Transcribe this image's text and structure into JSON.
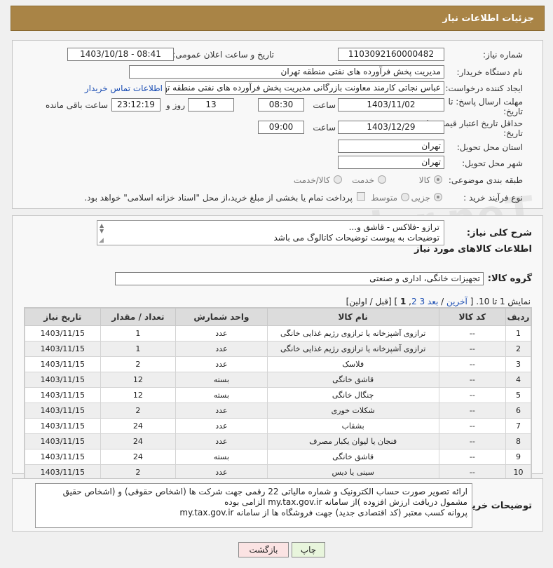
{
  "header": {
    "title": "جزئیات اطلاعات نیاز"
  },
  "form": {
    "need_number_label": "شماره نیاز:",
    "need_number": "1103092160000482",
    "announce_label": "تاریخ و ساعت اعلان عمومی:",
    "announce_value": "1403/10/18 - 08:41",
    "buyer_org_label": "نام دستگاه خریدار:",
    "buyer_org": "مدیریت پخش فرآورده های نفتی منطقه تهران",
    "creator_label": "ایجاد کننده درخواست:",
    "creator": "عباس نجاتی کارمند معاونت بازرگانی مدیریت پخش فرآورده های نفتی منطقه تهران",
    "contact_link": "اطلاعات تماس خریدار",
    "deadline_label": "مهلت ارسال پاسخ: تا تاریخ:",
    "deadline_date": "1403/11/02",
    "time_label": "ساعت",
    "deadline_time": "08:30",
    "days_value": "13",
    "days_label": "روز و",
    "remaining_time": "23:12:19",
    "remaining_label": "ساعت باقی مانده",
    "validity_label": "حداقل تاریخ اعتبار قیمت: تا تاریخ:",
    "validity_date": "1403/12/29",
    "validity_time": "09:00",
    "province_label": "استان محل تحویل:",
    "province": "تهران",
    "city_label": "شهر محل تحویل:",
    "city": "تهران",
    "category_label": "طبقه بندی موضوعی:",
    "category_options": [
      "کالا",
      "خدمت",
      "کالا/خدمت"
    ],
    "category_selected": "کالا",
    "process_label": "نوع فرآیند خرید :",
    "process_options": [
      "جزیی",
      "متوسط"
    ],
    "process_selected": "جزیی",
    "payment_note": "پرداخت تمام یا بخشی از مبلغ خرید،از محل \"اسناد خزانه اسلامی\" خواهد بود."
  },
  "description": {
    "label": "شرح کلی نیاز:",
    "line1": "ترازو -فلاکس - قاشق و...",
    "line2": "توضیحات به پیوست توضیحات کاتالوگ می باشد"
  },
  "goods": {
    "section_title": "اطلاعات کالاهای مورد نیاز",
    "group_label": "گروه کالا:",
    "group_value": "تجهیزات خانگی، اداری و صنعتی",
    "pagination": {
      "show_text": "نمایش 1 تا 10.",
      "open": "[",
      "last": "آخرین",
      "next": "بعد",
      "page3": "3",
      "page2": "2",
      "page1": "1",
      "close": "]",
      "tail": "[قبل / اولین]"
    },
    "columns": [
      "ردیف",
      "کد کالا",
      "نام کالا",
      "واحد شمارش",
      "تعداد / مقدار",
      "تاریخ نیاز"
    ],
    "rows": [
      [
        "1",
        "--",
        "ترازوی آشپزخانه یا ترازوی رژیم غذایی خانگی",
        "عدد",
        "1",
        "1403/11/15"
      ],
      [
        "2",
        "--",
        "ترازوی آشپزخانه یا ترازوی رژیم غذایی خانگی",
        "عدد",
        "1",
        "1403/11/15"
      ],
      [
        "3",
        "--",
        "فلاسک",
        "عدد",
        "2",
        "1403/11/15"
      ],
      [
        "4",
        "--",
        "قاشق خانگی",
        "بسته",
        "12",
        "1403/11/15"
      ],
      [
        "5",
        "--",
        "چنگال خانگی",
        "بسته",
        "12",
        "1403/11/15"
      ],
      [
        "6",
        "--",
        "شکلات خوری",
        "عدد",
        "2",
        "1403/11/15"
      ],
      [
        "7",
        "--",
        "بشقاب",
        "عدد",
        "24",
        "1403/11/15"
      ],
      [
        "8",
        "--",
        "فنجان یا لیوان یکبار مصرف",
        "عدد",
        "24",
        "1403/11/15"
      ],
      [
        "9",
        "--",
        "قاشق خانگی",
        "بسته",
        "24",
        "1403/11/15"
      ],
      [
        "10",
        "--",
        "سینی یا دیس",
        "عدد",
        "2",
        "1403/11/15"
      ]
    ]
  },
  "buyer_notes": {
    "label": "توضیحات خریدار:",
    "line1": "ارائه  تصویر صورت حساب الکترونیک و شماره مالیاتی 22 رقمی  جهت شرکت ها (اشخاص حقوقی) و (اشخاص حقیق",
    "line2": "مشمول دریافت ارزش افزوده )از سامانه my.tax.gov.ir  الزامی بوده",
    "line3": "پروانه کسب معتبر (کد اقتصادی جدید) جهت فروشگاه ها از سامانه my.tax.gov.ir"
  },
  "buttons": {
    "print": "چاپ",
    "back": "بازگشت"
  },
  "watermark": "AriaTender.neT"
}
